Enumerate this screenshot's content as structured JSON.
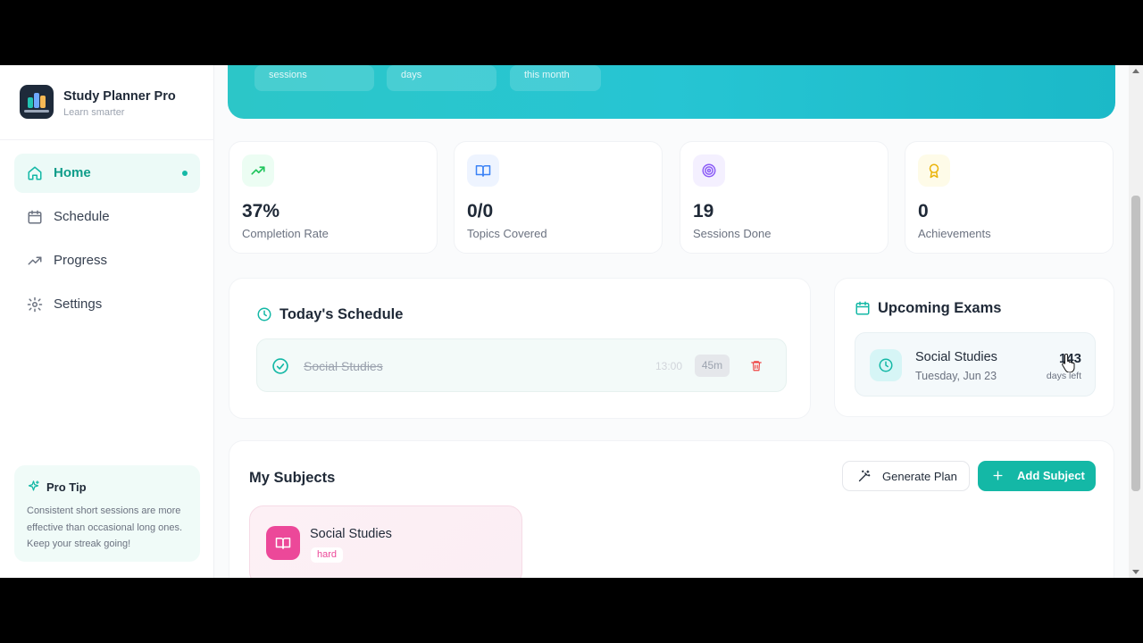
{
  "app": {
    "title": "Study Planner Pro",
    "subtitle": "Learn smarter",
    "logo_text": "Study Planner Pro"
  },
  "sidebar": {
    "items": [
      {
        "label": "Home",
        "icon": "home-icon",
        "active": true
      },
      {
        "label": "Schedule",
        "icon": "calendar-icon",
        "active": false
      },
      {
        "label": "Progress",
        "icon": "trending-up-icon",
        "active": false
      },
      {
        "label": "Settings",
        "icon": "gear-icon",
        "active": false
      }
    ],
    "tip": {
      "title": "Pro Tip",
      "text": "Consistent short sessions are more effective than occasional long ones. Keep your streak going!"
    }
  },
  "hero": {
    "chips": [
      "sessions",
      "days",
      "this month"
    ]
  },
  "stats": [
    {
      "value": "37%",
      "label": "Completion Rate",
      "icon": "trending-up-icon",
      "color": "#22c55e"
    },
    {
      "value": "0/0",
      "label": "Topics Covered",
      "icon": "book-icon",
      "color": "#3b82f6"
    },
    {
      "value": "19",
      "label": "Sessions Done",
      "icon": "target-icon",
      "color": "#8b5cf6"
    },
    {
      "value": "0",
      "label": "Achievements",
      "icon": "award-icon",
      "color": "#eab308"
    }
  ],
  "schedule": {
    "title": "Today's Schedule",
    "items": [
      {
        "subject": "Social Studies",
        "time": "13:00",
        "duration": "45m",
        "done": true
      }
    ]
  },
  "exams": {
    "title": "Upcoming Exams",
    "items": [
      {
        "subject": "Social Studies",
        "date": "Tuesday, Jun 23",
        "days": "143",
        "days_label": "days left"
      }
    ]
  },
  "subjects": {
    "title": "My Subjects",
    "generate_label": "Generate Plan",
    "add_label": "Add Subject",
    "items": [
      {
        "name": "Social Studies",
        "difficulty": "hard",
        "color": "#ec4899"
      }
    ]
  },
  "colors": {
    "accent": "#14b8a6",
    "hero_gradient_start": "#2cc6c8",
    "hero_gradient_end": "#1bb9c8"
  }
}
